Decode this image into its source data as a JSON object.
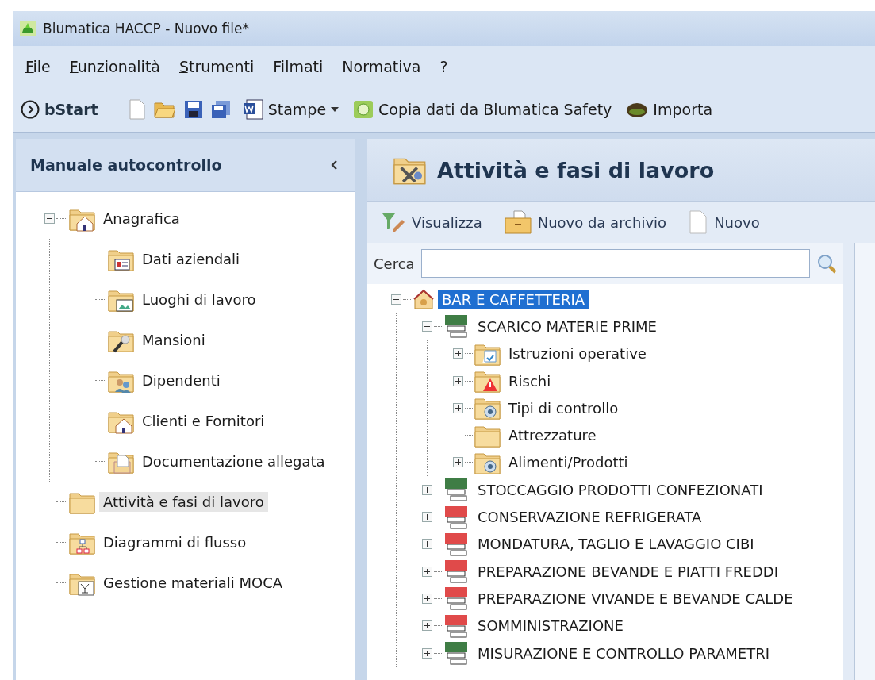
{
  "window": {
    "title": "Blumatica HACCP - Nuovo file*"
  },
  "menu": [
    {
      "label": "File",
      "underline_first": true
    },
    {
      "label": "Funzionalità",
      "underline_first": true
    },
    {
      "label": "Strumenti",
      "underline_first": true
    },
    {
      "label": "Filmati",
      "underline_first": false
    },
    {
      "label": "Normativa",
      "underline_first": false
    },
    {
      "label": "?",
      "underline_first": false
    }
  ],
  "toolbar": {
    "start_label": "bStart",
    "print_label": "Stampe",
    "copy_label": "Copia dati da Blumatica Safety",
    "import_label": "Importa"
  },
  "side_panel": {
    "title": "Manuale autocontrollo",
    "tree": [
      {
        "label": "Anagrafica",
        "selected": false,
        "expanded": true,
        "children": [
          {
            "label": "Dati aziendali",
            "selected": false
          },
          {
            "label": "Luoghi di lavoro",
            "selected": false
          },
          {
            "label": "Mansioni",
            "selected": false
          },
          {
            "label": "Dipendenti",
            "selected": false
          },
          {
            "label": "Clienti e Fornitori",
            "selected": false
          },
          {
            "label": "Documentazione allegata",
            "selected": false
          }
        ]
      },
      {
        "label": "Attività e fasi di lavoro",
        "selected": true
      },
      {
        "label": "Diagrammi di flusso",
        "selected": false
      },
      {
        "label": "Gestione materiali MOCA",
        "selected": false
      }
    ]
  },
  "work_panel": {
    "title": "Attività e fasi di lavoro",
    "actions": [
      "Visualizza",
      "Nuovo da archivio",
      "Nuovo"
    ],
    "search": {
      "label": "Cerca"
    },
    "tree": [
      {
        "label": "BAR E CAFFETTERIA",
        "selected": true,
        "expanded": true,
        "children": [
          {
            "label": "SCARICO MATERIE PRIME",
            "selected": false,
            "expanded": true,
            "color": "#3f7d45",
            "children": [
              {
                "label": "Istruzioni operative",
                "selected": false,
                "expanded": false
              },
              {
                "label": "Rischi",
                "selected": false,
                "expanded": false
              },
              {
                "label": "Tipi di controllo",
                "selected": false,
                "expanded": false
              },
              {
                "label": "Attrezzature",
                "selected": false
              },
              {
                "label": "Alimenti/Prodotti",
                "selected": false,
                "expanded": false
              }
            ]
          },
          {
            "label": "STOCCAGGIO PRODOTTI CONFEZIONATI",
            "selected": false,
            "expanded": false,
            "color": "#3f7d45"
          },
          {
            "label": "CONSERVAZIONE REFRIGERATA",
            "selected": false,
            "expanded": false,
            "color": "#e04a4a"
          },
          {
            "label": "MONDATURA, TAGLIO E LAVAGGIO CIBI",
            "selected": false,
            "expanded": false,
            "color": "#e04a4a"
          },
          {
            "label": "PREPARAZIONE BEVANDE E PIATTI FREDDI",
            "selected": false,
            "expanded": false,
            "color": "#e04a4a"
          },
          {
            "label": "PREPARAZIONE VIVANDE E BEVANDE CALDE",
            "selected": false,
            "expanded": false,
            "color": "#e04a4a"
          },
          {
            "label": "SOMMINISTRAZIONE",
            "selected": false,
            "expanded": false,
            "color": "#e04a4a"
          },
          {
            "label": "MISURAZIONE E CONTROLLO PARAMETRI",
            "selected": false,
            "expanded": false,
            "color": "#3f7d45"
          }
        ]
      }
    ]
  }
}
